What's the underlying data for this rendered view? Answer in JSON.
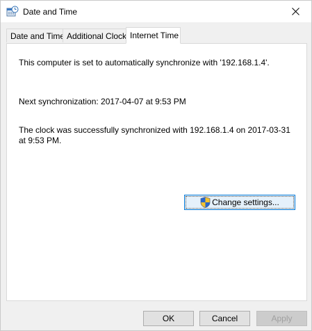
{
  "window": {
    "title": "Date and Time",
    "icon": "date-time-icon",
    "close_icon": "close-icon"
  },
  "tabs": [
    {
      "label": "Date and Time",
      "active": false
    },
    {
      "label": "Additional Clocks",
      "active": false
    },
    {
      "label": "Internet Time",
      "active": true
    }
  ],
  "panel": {
    "sync_status": "This computer is set to automatically synchronize with '192.168.1.4'.",
    "next_sync": "Next synchronization: 2017-04-07 at 9:53 PM",
    "last_sync": "The clock was successfully synchronized with 192.168.1.4 on 2017-03-31 at 9:53 PM.",
    "change_settings_label": "Change settings...",
    "change_settings_icon": "uac-shield-icon"
  },
  "footer": {
    "ok_label": "OK",
    "cancel_label": "Cancel",
    "apply_label": "Apply"
  },
  "colors": {
    "accent": "#0078d7",
    "panel_bg": "#ffffff",
    "dialog_bg": "#f0f0f0"
  }
}
